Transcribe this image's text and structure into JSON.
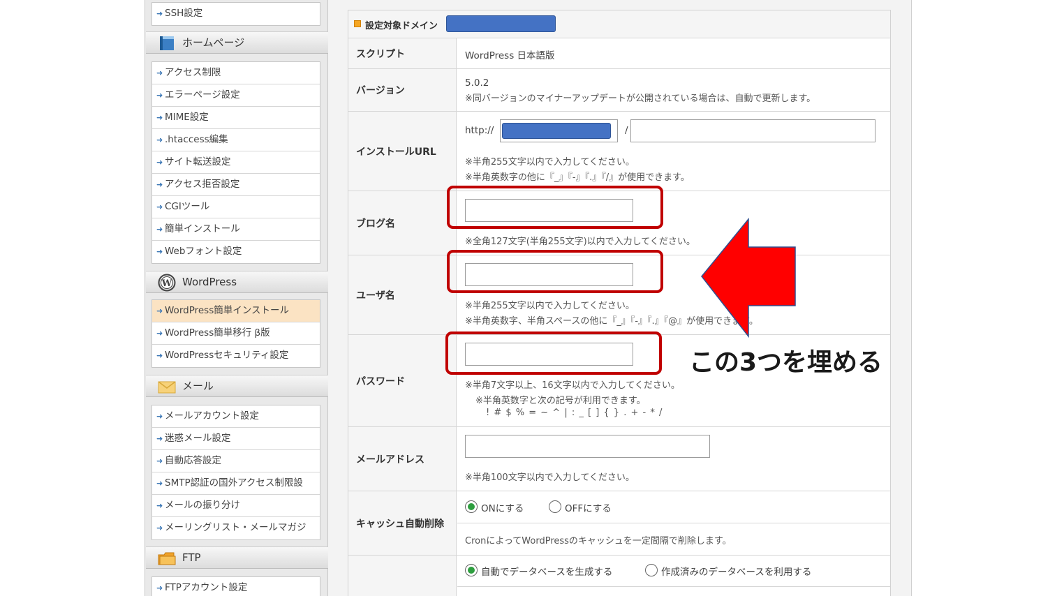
{
  "sidebar": {
    "top_items": [
      "SSH設定"
    ],
    "sections": [
      {
        "title": "ホームページ",
        "icon": "homepage-book-icon",
        "items": [
          "アクセス制限",
          "エラーページ設定",
          "MIME設定",
          ".htaccess編集",
          "サイト転送設定",
          "アクセス拒否設定",
          "CGIツール",
          "簡単インストール",
          "Webフォント設定"
        ]
      },
      {
        "title": "WordPress",
        "icon": "wordpress-logo-icon",
        "items": [
          "WordPress簡単インストール",
          "WordPress簡単移行 β版",
          "WordPressセキュリティ設定"
        ]
      },
      {
        "title": "メール",
        "icon": "mail-envelope-icon",
        "items": [
          "メールアカウント設定",
          "迷惑メール設定",
          "自動応答設定",
          "SMTP認証の国外アクセス制限設",
          "メールの振り分け",
          "メーリングリスト・メールマガジ"
        ]
      },
      {
        "title": "FTP",
        "icon": "ftp-folder-icon",
        "items": [
          "FTPアカウント設定"
        ]
      }
    ]
  },
  "form": {
    "domain_label": "設定対象ドメイン",
    "script": {
      "label": "スクリプト",
      "value": "WordPress 日本語版"
    },
    "version": {
      "label": "バージョン",
      "value": "5.0.2",
      "note": "※同バージョンのマイナーアップデートが公開されている場合は、自動で更新します。"
    },
    "install_url": {
      "label": "インストールURL",
      "prefix": "http://",
      "separator": "/",
      "path_value": "",
      "note1": "※半角255文字以内で入力してください。",
      "note2": "※半角英数字の他に『_』『-』『.』『/』が使用できます。"
    },
    "blog_name": {
      "label": "ブログ名",
      "value": "",
      "note": "※全角127文字(半角255文字)以内で入力してください。"
    },
    "user_name": {
      "label": "ユーザ名",
      "value": "",
      "note1": "※半角255文字以内で入力してください。",
      "note2": "※半角英数字、半角スペースの他に『_』『-』『.』『@』が使用できます。"
    },
    "password": {
      "label": "パスワード",
      "value": "",
      "note1": "※半角7文字以上、16文字以内で入力してください。",
      "note2": "※半角英数字と次の記号が利用できます。",
      "note3": "! # $ % = ~ ^ | : _ [ ] { } . + - * /"
    },
    "email": {
      "label": "メールアドレス",
      "value": "",
      "note": "※半角100文字以内で入力してください。"
    },
    "cache": {
      "label": "キャッシュ自動削除",
      "on_label": "ONにする",
      "off_label": "OFFにする",
      "selected": "on",
      "note": "CronによってWordPressのキャッシュを一定間隔で削除します。"
    },
    "database": {
      "auto_label": "自動でデータベースを生成する",
      "existing_label": "作成済みのデータベースを利用する",
      "selected": "auto"
    }
  },
  "annotation": {
    "callout": "この3つを埋める",
    "highlight_color": "#c00000",
    "arrow_color": "#ff0000"
  }
}
